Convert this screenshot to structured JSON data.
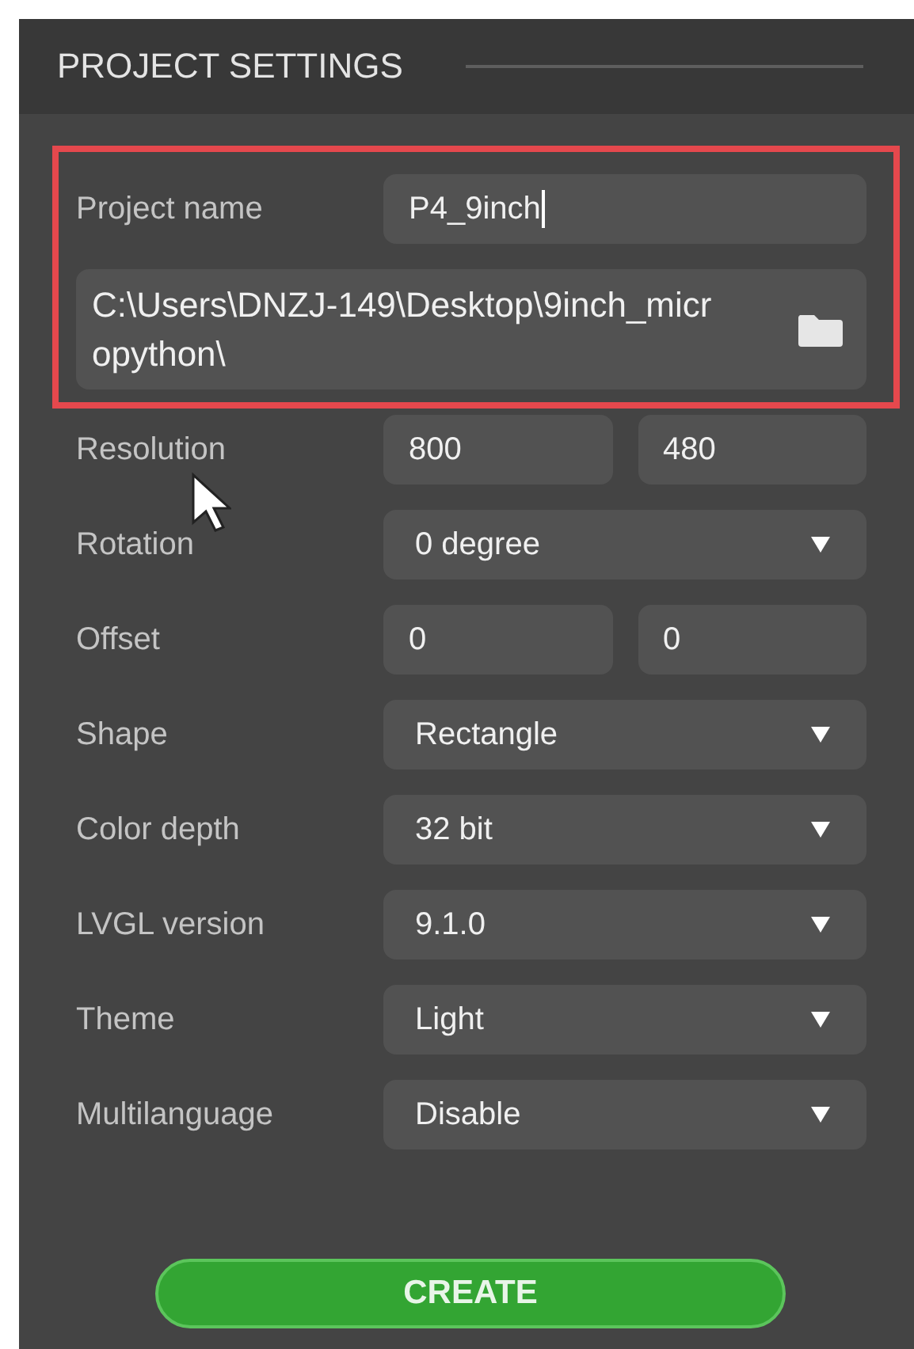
{
  "header": {
    "title": "PROJECT SETTINGS"
  },
  "highlight": {
    "project_name": {
      "label": "Project name",
      "value": "P4_9inch",
      "focused": true
    },
    "path": {
      "value": "C:\\Users\\DNZJ-149\\Desktop\\9inch_micropython\\"
    }
  },
  "rows": [
    {
      "kind": "pair",
      "label": "Resolution",
      "values": [
        "800",
        "480"
      ]
    },
    {
      "kind": "select",
      "label": "Rotation",
      "value": "0 degree"
    },
    {
      "kind": "pair",
      "label": "Offset",
      "values": [
        "0",
        "0"
      ]
    },
    {
      "kind": "select",
      "label": "Shape",
      "value": "Rectangle"
    },
    {
      "kind": "select",
      "label": "Color depth",
      "value": "32 bit"
    },
    {
      "kind": "select",
      "label": "LVGL version",
      "value": "9.1.0"
    },
    {
      "kind": "select",
      "label": "Theme",
      "value": "Light"
    },
    {
      "kind": "select",
      "label": "Multilanguage",
      "value": "Disable"
    }
  ],
  "create_button": {
    "label": "CREATE"
  }
}
